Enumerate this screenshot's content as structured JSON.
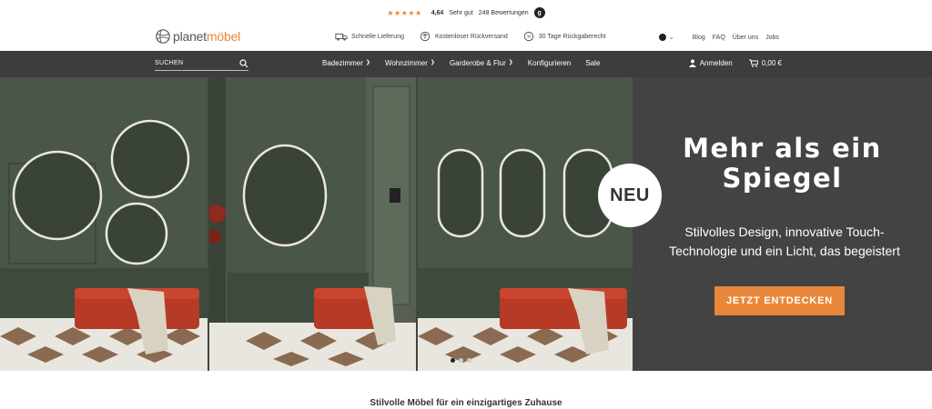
{
  "rating": {
    "stars": "★★★★★",
    "score": "4,64",
    "verdict": "Sehr gut",
    "reviews": "248 Bewertungen",
    "badge": "g"
  },
  "header": {
    "logo": {
      "part1": "planet",
      "part2": "möbel"
    },
    "usps": [
      {
        "icon": "truck-icon",
        "label": "Schnelle Lieferung"
      },
      {
        "icon": "return-icon",
        "label": "Kostenloser Rückversand"
      },
      {
        "icon": "days-30-icon",
        "label": "30 Tage Rückgaberecht"
      }
    ],
    "links": [
      "Blog",
      "FAQ",
      "Über uns",
      "Jobs"
    ]
  },
  "nav": {
    "search_label": "SUCHEN",
    "items": [
      {
        "label": "Badezimmer",
        "has_dropdown": true
      },
      {
        "label": "Wohnzimmer",
        "has_dropdown": true
      },
      {
        "label": "Garderobe & Flur",
        "has_dropdown": true
      },
      {
        "label": "Konfigurieren",
        "has_dropdown": false
      },
      {
        "label": "Sale",
        "has_dropdown": false
      }
    ],
    "login": "Anmelden",
    "cart": "0,00 €"
  },
  "hero": {
    "badge": "NEU",
    "title_line1": "Mehr als ein",
    "title_line2": "Spiegel",
    "subtitle_line1": "Stilvolles Design, innovative Touch-",
    "subtitle_line2": "Technologie und ein Licht, das begeistert",
    "cta": "JETZT ENTDECKEN",
    "slides": 3,
    "active_slide": 1
  },
  "tagline": "Stilvolle Möbel für ein einzigartiges Zuhause",
  "colors": {
    "accent": "#e8873a",
    "nav_bg": "#3d3d3d",
    "hero_bg": "#434343",
    "wall_green": "#4b5749"
  }
}
